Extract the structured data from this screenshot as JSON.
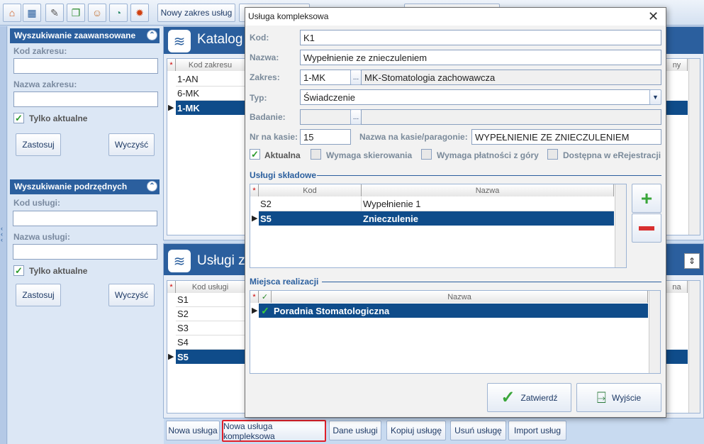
{
  "toolbar": {
    "icons": [
      "home-icon",
      "calendar-icon",
      "notes-icon",
      "documents-icon",
      "users-icon",
      "clock-icon",
      "gear-icon"
    ],
    "tab_new_range": "Nowy zakres usług"
  },
  "left": {
    "adv_title": "Wyszukiwanie zaawansowane",
    "range_code_label": "Kod zakresu:",
    "range_code_value": "",
    "range_name_label": "Nazwa zakresu:",
    "range_name_value": "",
    "only_current_label": "Tylko aktualne",
    "apply_label": "Zastosuj",
    "clear_label": "Wyczyść",
    "sub_title": "Wyszukiwanie podrzędnych",
    "service_code_label": "Kod usługi:",
    "service_code_value": "",
    "service_name_label": "Nazwa usługi:",
    "service_name_value": "",
    "only_current_label2": "Tylko aktualne",
    "apply_label2": "Zastosuj",
    "clear_label2": "Wyczyść"
  },
  "catalog": {
    "title": "Katalog",
    "col_code": "Kod zakresu",
    "col_right": "ny",
    "rows": [
      "1-AN",
      "6-MK",
      "1-MK"
    ]
  },
  "services": {
    "title": "Usługi z",
    "col_code": "Kod usługi",
    "col_right": "na",
    "rows": [
      "S1",
      "S2",
      "S3",
      "S4",
      "S5"
    ]
  },
  "bottom": {
    "new_service": "Nowa usługa",
    "new_complex": "Nowa usługa kompleksowa",
    "service_data": "Dane usługi",
    "copy_service": "Kopiuj usługę",
    "delete_service": "Usuń usługę",
    "import_service": "Import usług"
  },
  "dialog": {
    "title": "Usługa kompleksowa",
    "code_label": "Kod:",
    "code_value": "K1",
    "name_label": "Nazwa:",
    "name_value": "Wypełnienie ze znieczuleniem",
    "range_label": "Zakres:",
    "range_code": "1-MK",
    "range_name": "MK-Stomatologia zachowawcza",
    "type_label": "Typ:",
    "type_value": "Świadczenie",
    "exam_label": "Badanie:",
    "exam_value": "",
    "cash_no_label": "Nr na kasie:",
    "cash_no_value": "15",
    "cash_name_label": "Nazwa na kasie/paragonie:",
    "cash_name_value": "WYPEŁNIENIE ZE ZNIECZULENIEM",
    "chk_current": "Aktualna",
    "chk_referral": "Wymaga skierowania",
    "chk_prepay": "Wymaga płatności z góry",
    "chk_ereg": "Dostępna w eRejestracji",
    "components_title": "Usługi składowe",
    "comp_col_code": "Kod",
    "comp_col_name": "Nazwa",
    "components": [
      {
        "code": "S2",
        "name": "Wypełnienie 1"
      },
      {
        "code": "S5",
        "name": "Znieczulenie"
      }
    ],
    "places_title": "Miejsca realizacji",
    "places_col_name": "Nazwa",
    "places": [
      "Poradnia Stomatologiczna"
    ],
    "confirm": "Zatwierdź",
    "exit": "Wyjście",
    "browse": "..."
  }
}
